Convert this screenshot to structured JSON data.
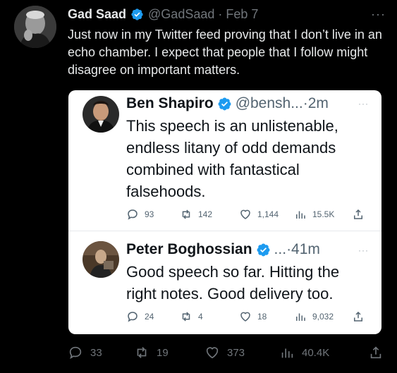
{
  "tweet": {
    "author_name": "Gad Saad",
    "author_handle": "@GadSaad",
    "separator": "·",
    "date": "Feb 7",
    "more": "···",
    "text": "Just now in my Twitter feed proving that I don’t live in an echo chamber.  I expect that people that I follow might disagree on important matters.",
    "metrics": {
      "replies": "33",
      "retweets": "19",
      "likes": "373",
      "views": "40.4K"
    }
  },
  "embedded": [
    {
      "author_name": "Ben Shapiro",
      "author_handle": "@bensh...",
      "time": "·2m",
      "more": "···",
      "text": "This speech is an unlistenable, endless litany of odd demands combined with fantastical falsehoods.",
      "metrics": {
        "replies": "93",
        "retweets": "142",
        "likes": "1,144",
        "views": "15.5K"
      }
    },
    {
      "author_name": "Peter Boghossian",
      "author_handle": "...",
      "time": "·41m",
      "more": "···",
      "text": "Good speech so far. Hitting the right notes. Good delivery too.",
      "metrics": {
        "replies": "24",
        "retweets": "4",
        "likes": "18",
        "views": "9,032"
      }
    }
  ],
  "colors": {
    "background": "#000000",
    "verified_blue": "#1d9bf0",
    "text_primary": "#e7e9ea",
    "text_secondary": "#71767b"
  },
  "icons": [
    "verified-badge-icon",
    "reply-icon",
    "retweet-icon",
    "like-icon",
    "views-icon",
    "share-icon",
    "more-icon"
  ]
}
